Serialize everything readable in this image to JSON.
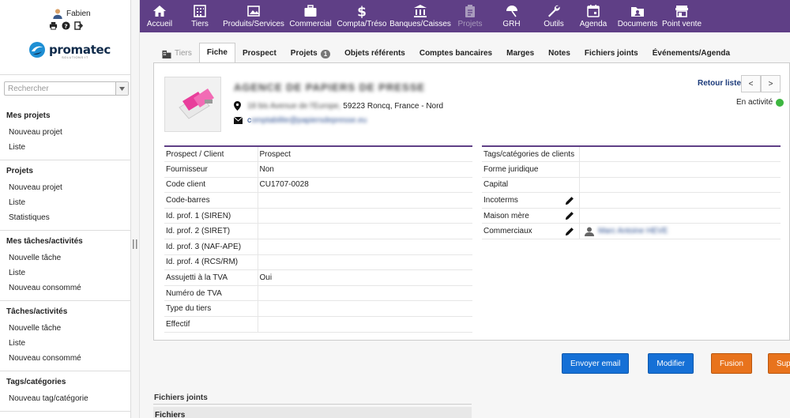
{
  "user": {
    "name": "Fabien"
  },
  "brand": {
    "logo_text": "promatec",
    "logo_sub": "SOLUTIONS IT"
  },
  "search": {
    "placeholder": "Rechercher"
  },
  "sidebar": [
    {
      "title": "Mes projets",
      "items": [
        "Nouveau projet",
        "Liste"
      ]
    },
    {
      "title": "Projets",
      "items": [
        "Nouveau projet",
        "Liste",
        "Statistiques"
      ]
    },
    {
      "title": "Mes tâches/activités",
      "items": [
        "Nouvelle tâche",
        "Liste",
        "Nouveau consommé"
      ]
    },
    {
      "title": "Tâches/activités",
      "items": [
        "Nouvelle tâche",
        "Liste",
        "Nouveau consommé"
      ]
    },
    {
      "title": "Tags/catégories",
      "items": [
        "Nouveau tag/catégorie"
      ]
    }
  ],
  "topnav": [
    {
      "label": "Accueil",
      "icon": "home-icon"
    },
    {
      "label": "Tiers",
      "icon": "building-icon"
    },
    {
      "label": "Produits/Services",
      "icon": "product-icon"
    },
    {
      "label": "Commercial",
      "icon": "briefcase-icon"
    },
    {
      "label": "Compta/Tréso",
      "icon": "dollar-icon"
    },
    {
      "label": "Banques/Caisses",
      "icon": "bank-icon"
    },
    {
      "label": "Projets",
      "icon": "clipboard-icon",
      "dim": true
    },
    {
      "label": "GRH",
      "icon": "umbrella-icon"
    },
    {
      "label": "Outils",
      "icon": "wrench-icon"
    },
    {
      "label": "Agenda",
      "icon": "calendar-icon"
    },
    {
      "label": "Documents",
      "icon": "folder-icon"
    },
    {
      "label": "Point vente",
      "icon": "store-icon"
    }
  ],
  "tabs": [
    {
      "label": "Tiers",
      "dim": true
    },
    {
      "label": "Fiche",
      "active": true
    },
    {
      "label": "Prospect"
    },
    {
      "label": "Projets",
      "badge": "1"
    },
    {
      "label": "Objets référents"
    },
    {
      "label": "Comptes bancaires"
    },
    {
      "label": "Marges"
    },
    {
      "label": "Notes"
    },
    {
      "label": "Fichiers joints"
    },
    {
      "label": "Événements/Agenda"
    }
  ],
  "company": {
    "name": "AGENCE DE PAPIERS DE PRESSE",
    "address_blurred": "18 bis Avenue de l'Europe,",
    "address_visible": "59223 Roncq, France - Nord",
    "email_first": "c",
    "email_blurred": "omptabilite@papiersdepresse.eu",
    "status": "En activité",
    "retour": "Retour liste",
    "prev": "<",
    "next": ">"
  },
  "fields_left": [
    {
      "k": "Prospect / Client",
      "v": "Prospect"
    },
    {
      "k": "Fournisseur",
      "v": "Non"
    },
    {
      "k": "Code client",
      "v": "CU1707-0028"
    },
    {
      "k": "Code-barres",
      "v": ""
    },
    {
      "k": "Id. prof. 1 (SIREN)",
      "v": ""
    },
    {
      "k": "Id. prof. 2 (SIRET)",
      "v": ""
    },
    {
      "k": "Id. prof. 3 (NAF-APE)",
      "v": ""
    },
    {
      "k": "Id. prof. 4 (RCS/RM)",
      "v": ""
    },
    {
      "k": "Assujetti à la TVA",
      "v": "Oui"
    },
    {
      "k": "Numéro de TVA",
      "v": ""
    },
    {
      "k": "Type du tiers",
      "v": ""
    },
    {
      "k": "Effectif",
      "v": ""
    }
  ],
  "fields_right": [
    {
      "k": "Tags/catégories de clients",
      "v": "",
      "edit": false
    },
    {
      "k": "Forme juridique",
      "v": "",
      "edit": false
    },
    {
      "k": "Capital",
      "v": "",
      "edit": false
    },
    {
      "k": "Incoterms",
      "v": "",
      "edit": true
    },
    {
      "k": "Maison mère",
      "v": "",
      "edit": true
    },
    {
      "k": "Commerciaux",
      "v": "Marc Antoine HEVE",
      "edit": true,
      "user": true
    }
  ],
  "actions": {
    "email": "Envoyer email",
    "modify": "Modifier",
    "merge": "Fusion",
    "delete": "Supprimer"
  },
  "files": {
    "title": "Fichiers joints",
    "header": "Fichiers"
  },
  "colors": {
    "nav": "#5f3f86",
    "primary_btn": "#1570d6",
    "warn_btn": "#e8731c",
    "active": "#3db640"
  }
}
